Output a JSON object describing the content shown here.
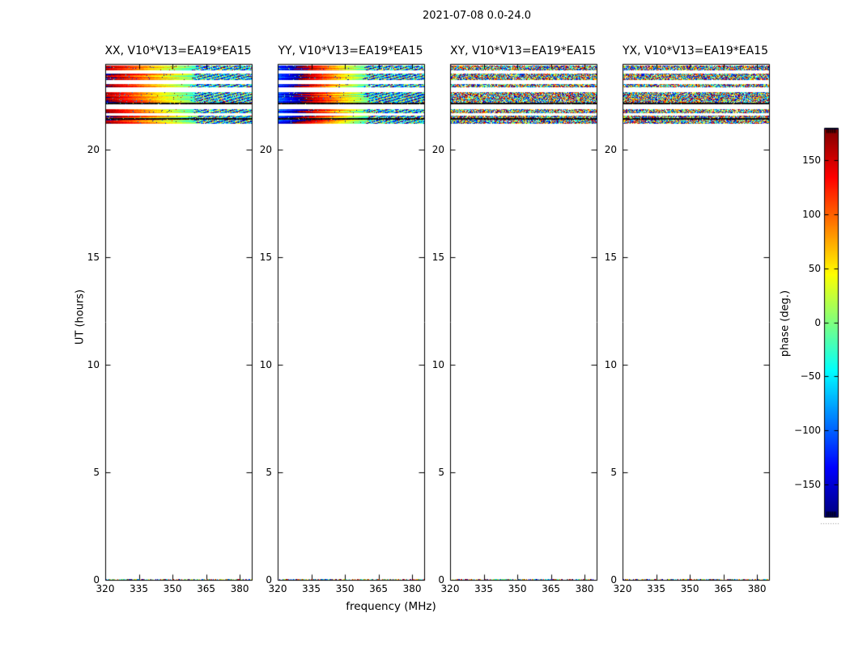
{
  "chart_data": {
    "type": "heatmap",
    "title": "2021-07-08 0.0-24.0",
    "xlabel": "frequency (MHz)",
    "ylabel": "UT (hours)",
    "x_ticks": [
      320,
      335,
      350,
      365,
      380
    ],
    "y_ticks": [
      0,
      5,
      10,
      15,
      20
    ],
    "x_range_mhz": [
      320,
      385.4
    ],
    "y_range_hours": [
      0,
      24
    ],
    "grid": false,
    "colormap": "jet",
    "colorbar": {
      "label": "phase (deg.)",
      "min": -180,
      "max": 180,
      "ticks": [
        150,
        100,
        50,
        0,
        -50,
        -100,
        -150
      ],
      "top_color": "#800000",
      "bottom_color": "#000080"
    },
    "panels": [
      {
        "title": "XX, V10*V13=EA19*EA15",
        "mode": "gradient",
        "phase_at_320mhz_deg": 172,
        "phase_slope_deg_per_mhz": -4.8,
        "noise_start_mhz": 359,
        "seed": 11
      },
      {
        "title": "YY, V10*V13=EA19*EA15",
        "mode": "gradient",
        "phase_at_320mhz_deg": -112,
        "phase_slope_deg_per_mhz": -6.8,
        "noise_start_mhz": 359,
        "seed": 22
      },
      {
        "title": "XY, V10*V13=EA19*EA15",
        "mode": "noise",
        "seed": 33
      },
      {
        "title": "YX, V10*V13=EA19*EA15",
        "mode": "noise",
        "seed": 44
      }
    ],
    "data_segments_ut_hours": [
      [
        23.7,
        23.96
      ],
      [
        23.25,
        23.55
      ],
      [
        22.91,
        23.06
      ],
      [
        22.19,
        22.72
      ],
      [
        21.71,
        21.93
      ],
      [
        21.44,
        21.63
      ],
      [
        21.25,
        21.41
      ],
      [
        0.0,
        0.07
      ]
    ],
    "black_line_rows_ut_hours": [
      22.21,
      21.49
    ]
  }
}
